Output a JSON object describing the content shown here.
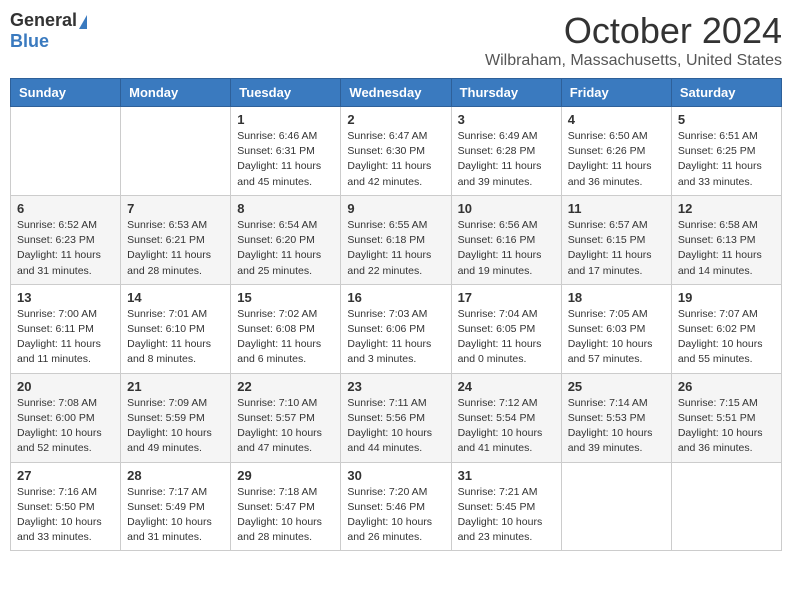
{
  "logo": {
    "general": "General",
    "blue": "Blue"
  },
  "header": {
    "month": "October 2024",
    "location": "Wilbraham, Massachusetts, United States"
  },
  "days_of_week": [
    "Sunday",
    "Monday",
    "Tuesday",
    "Wednesday",
    "Thursday",
    "Friday",
    "Saturday"
  ],
  "weeks": [
    [
      {
        "day": "",
        "info": ""
      },
      {
        "day": "",
        "info": ""
      },
      {
        "day": "1",
        "info": "Sunrise: 6:46 AM\nSunset: 6:31 PM\nDaylight: 11 hours and 45 minutes."
      },
      {
        "day": "2",
        "info": "Sunrise: 6:47 AM\nSunset: 6:30 PM\nDaylight: 11 hours and 42 minutes."
      },
      {
        "day": "3",
        "info": "Sunrise: 6:49 AM\nSunset: 6:28 PM\nDaylight: 11 hours and 39 minutes."
      },
      {
        "day": "4",
        "info": "Sunrise: 6:50 AM\nSunset: 6:26 PM\nDaylight: 11 hours and 36 minutes."
      },
      {
        "day": "5",
        "info": "Sunrise: 6:51 AM\nSunset: 6:25 PM\nDaylight: 11 hours and 33 minutes."
      }
    ],
    [
      {
        "day": "6",
        "info": "Sunrise: 6:52 AM\nSunset: 6:23 PM\nDaylight: 11 hours and 31 minutes."
      },
      {
        "day": "7",
        "info": "Sunrise: 6:53 AM\nSunset: 6:21 PM\nDaylight: 11 hours and 28 minutes."
      },
      {
        "day": "8",
        "info": "Sunrise: 6:54 AM\nSunset: 6:20 PM\nDaylight: 11 hours and 25 minutes."
      },
      {
        "day": "9",
        "info": "Sunrise: 6:55 AM\nSunset: 6:18 PM\nDaylight: 11 hours and 22 minutes."
      },
      {
        "day": "10",
        "info": "Sunrise: 6:56 AM\nSunset: 6:16 PM\nDaylight: 11 hours and 19 minutes."
      },
      {
        "day": "11",
        "info": "Sunrise: 6:57 AM\nSunset: 6:15 PM\nDaylight: 11 hours and 17 minutes."
      },
      {
        "day": "12",
        "info": "Sunrise: 6:58 AM\nSunset: 6:13 PM\nDaylight: 11 hours and 14 minutes."
      }
    ],
    [
      {
        "day": "13",
        "info": "Sunrise: 7:00 AM\nSunset: 6:11 PM\nDaylight: 11 hours and 11 minutes."
      },
      {
        "day": "14",
        "info": "Sunrise: 7:01 AM\nSunset: 6:10 PM\nDaylight: 11 hours and 8 minutes."
      },
      {
        "day": "15",
        "info": "Sunrise: 7:02 AM\nSunset: 6:08 PM\nDaylight: 11 hours and 6 minutes."
      },
      {
        "day": "16",
        "info": "Sunrise: 7:03 AM\nSunset: 6:06 PM\nDaylight: 11 hours and 3 minutes."
      },
      {
        "day": "17",
        "info": "Sunrise: 7:04 AM\nSunset: 6:05 PM\nDaylight: 11 hours and 0 minutes."
      },
      {
        "day": "18",
        "info": "Sunrise: 7:05 AM\nSunset: 6:03 PM\nDaylight: 10 hours and 57 minutes."
      },
      {
        "day": "19",
        "info": "Sunrise: 7:07 AM\nSunset: 6:02 PM\nDaylight: 10 hours and 55 minutes."
      }
    ],
    [
      {
        "day": "20",
        "info": "Sunrise: 7:08 AM\nSunset: 6:00 PM\nDaylight: 10 hours and 52 minutes."
      },
      {
        "day": "21",
        "info": "Sunrise: 7:09 AM\nSunset: 5:59 PM\nDaylight: 10 hours and 49 minutes."
      },
      {
        "day": "22",
        "info": "Sunrise: 7:10 AM\nSunset: 5:57 PM\nDaylight: 10 hours and 47 minutes."
      },
      {
        "day": "23",
        "info": "Sunrise: 7:11 AM\nSunset: 5:56 PM\nDaylight: 10 hours and 44 minutes."
      },
      {
        "day": "24",
        "info": "Sunrise: 7:12 AM\nSunset: 5:54 PM\nDaylight: 10 hours and 41 minutes."
      },
      {
        "day": "25",
        "info": "Sunrise: 7:14 AM\nSunset: 5:53 PM\nDaylight: 10 hours and 39 minutes."
      },
      {
        "day": "26",
        "info": "Sunrise: 7:15 AM\nSunset: 5:51 PM\nDaylight: 10 hours and 36 minutes."
      }
    ],
    [
      {
        "day": "27",
        "info": "Sunrise: 7:16 AM\nSunset: 5:50 PM\nDaylight: 10 hours and 33 minutes."
      },
      {
        "day": "28",
        "info": "Sunrise: 7:17 AM\nSunset: 5:49 PM\nDaylight: 10 hours and 31 minutes."
      },
      {
        "day": "29",
        "info": "Sunrise: 7:18 AM\nSunset: 5:47 PM\nDaylight: 10 hours and 28 minutes."
      },
      {
        "day": "30",
        "info": "Sunrise: 7:20 AM\nSunset: 5:46 PM\nDaylight: 10 hours and 26 minutes."
      },
      {
        "day": "31",
        "info": "Sunrise: 7:21 AM\nSunset: 5:45 PM\nDaylight: 10 hours and 23 minutes."
      },
      {
        "day": "",
        "info": ""
      },
      {
        "day": "",
        "info": ""
      }
    ]
  ]
}
